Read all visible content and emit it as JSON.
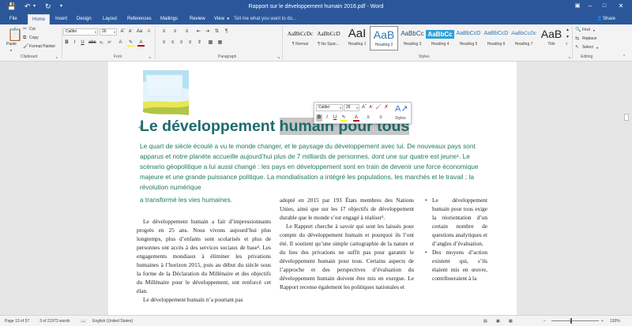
{
  "window": {
    "title": "Rapport sur le développement humain 2016.pdf - Word",
    "qat_icons": [
      "save-icon",
      "undo-icon",
      "redo-icon",
      "customize-icon"
    ],
    "controls": [
      "ribbon-display-icon",
      "minimize-icon",
      "maximize-icon",
      "close-icon"
    ]
  },
  "tabs": [
    "File",
    "Home",
    "Insert",
    "Design",
    "Layout",
    "References",
    "Mailings",
    "Review",
    "View"
  ],
  "tell_me": "Tell me what you want to do...",
  "share": "Share",
  "ribbon": {
    "clipboard": {
      "paste": "Paste",
      "cut": "Cut",
      "copy": "Copy",
      "format_painter": "Format Painter",
      "label": "Clipboard"
    },
    "font": {
      "name": "Calibri",
      "size": "26",
      "label": "Font"
    },
    "paragraph": {
      "label": "Paragraph"
    },
    "styles": {
      "label": "Styles",
      "items": [
        {
          "sample": "AaBbCcDc",
          "name": "¶ Normal"
        },
        {
          "sample": "AaBbCcD",
          "name": "¶ No Spac..."
        },
        {
          "sample": "AaI",
          "name": "Heading 1"
        },
        {
          "sample": "AaB",
          "name": "Heading 2"
        },
        {
          "sample": "AaBbCc",
          "name": "Heading 3"
        },
        {
          "sample": "AaBbCc",
          "name": "Heading 4"
        },
        {
          "sample": "AaBbCcD",
          "name": "Heading 5"
        },
        {
          "sample": "AaBbCcD",
          "name": "Heading 6"
        },
        {
          "sample": "AaBbCcDc",
          "name": "Heading 7"
        },
        {
          "sample": "AaB",
          "name": "Title"
        }
      ]
    },
    "editing": {
      "find": "Find",
      "replace": "Replace",
      "select": "Select",
      "label": "Editing"
    }
  },
  "mini_toolbar": {
    "font": "Calibri",
    "size": "26",
    "styles_label": "Styles"
  },
  "document": {
    "heading_part1": "Le développement ",
    "heading_part2": "humain pour tous",
    "intro": "Le quart de siècle écoulé a vu le monde changer, et le paysage du développement avec lui. De nouveaux pays sont apparus et notre planète accueille aujourd’hui plus de 7 milliards de personnes, dont une sur quatre est jeune¹. Le scénario géopolitique a lui aussi changé : les pays en développement sont en train de devenir une force économique majeure et une grande puissance politique. La mondialisation a intégré les populations, les marchés et le travail ; la révolution numérique",
    "intro_cont": "a transformé les vies humaines.",
    "col1": [
      "Le développement humain a fait d’impressionnants progrès en 25 ans. Nous vivons aujourd’hui plus longtemps, plus d’enfants sont scolarisés et plus de personnes ont accès à des services sociaux de base². Les engagements mondiaux à éliminer les privations humaines à l’horizon 2015, puis au début du siècle sous la forme de la Déclaration du Millénaire et des objectifs du Millénaire pour le développement, ont renforcé cet élan.",
      "Le développement humain n’a pourtant pas"
    ],
    "col2": [
      "adopté en 2015 par 193 États membres des Nations Unies, ainsi que sur les 17 objectifs de développement durable que le monde s’est engagé à réaliser³.",
      "Le Rapport cherche à savoir qui sont les laissés pour compte du développement humain et pourquoi ils l’ont été. Il soutient qu’une simple cartographie de la nature et du lieu des privations ne suffit pas pour garantir le développement humain pour tous. Certains aspects de l’approche et des perspectives d’évaluation du développement humain doivent être mis en exergue. Le Rapport recense également les politiques nationales et"
    ],
    "col3": [
      "Le développement humain pour tous exige la réorientation d’un certain nombre de questions analytiques et d’angles d’évaluation.",
      "Des moyens d’action existent qui, s’ils étaient mis en œuvre, contribueraient à la"
    ]
  },
  "status": {
    "page": "Page 13 of 57",
    "words": "3 of 21973 words",
    "language": "English (United States)",
    "zoom": "130%"
  },
  "colors": {
    "brand": "#2b579a",
    "heading": "#1e6b6b",
    "intro": "#1e7b5e"
  }
}
